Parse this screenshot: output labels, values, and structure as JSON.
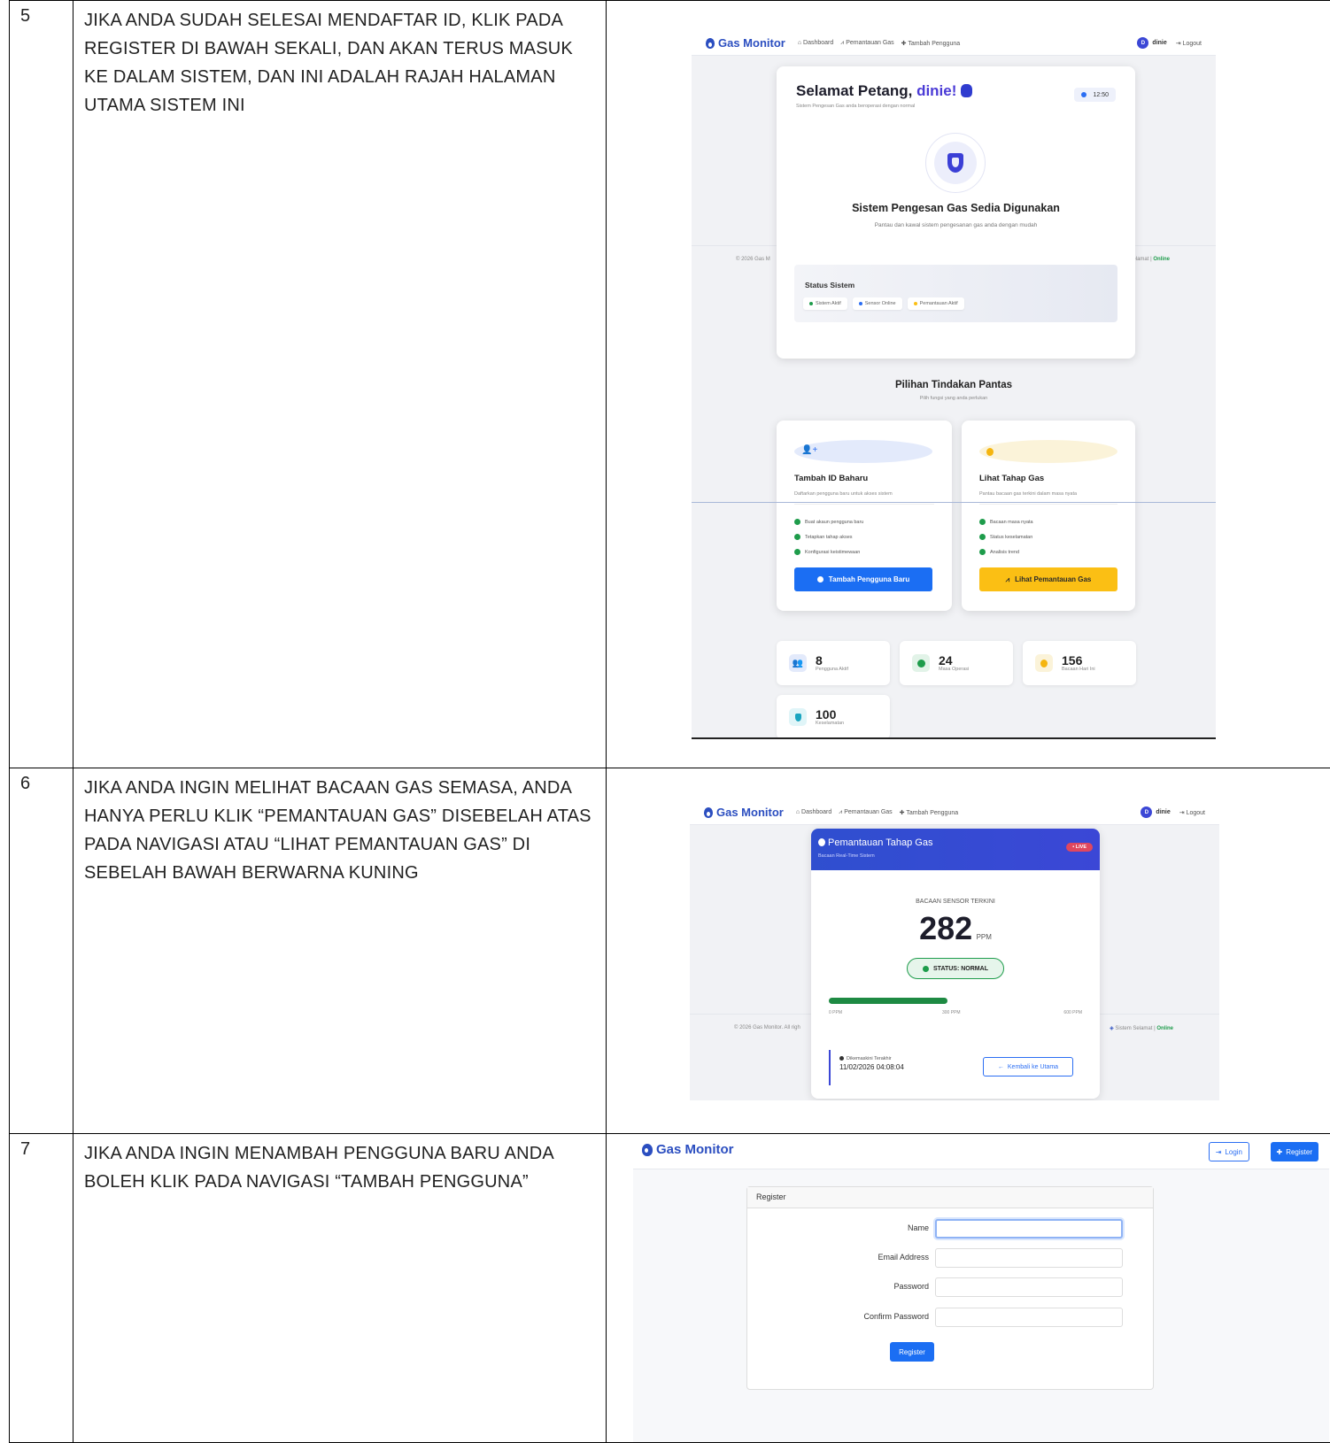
{
  "rows": [
    {
      "no": "5",
      "instruction": "JIKA ANDA SUDAH SELESAI MENDAFTAR ID, KLIK PADA REGISTER DI BAWAH SEKALI, DAN AKAN TERUS MASUK KE DALAM SISTEM, DAN INI ADALAH RAJAH HALAMAN UTAMA SISTEM INI"
    },
    {
      "no": "6",
      "instruction": "JIKA ANDA INGIN MELIHAT BACAAN GAS SEMASA, ANDA HANYA PERLU KLIK “PEMANTAUAN GAS” DISEBELAH ATAS PADA NAVIGASI ATAU “LIHAT PEMANTAUAN GAS” DI SEBELAH BAWAH BERWARNA KUNING"
    },
    {
      "no": "7",
      "instruction": "JIKA ANDA INGIN MENAMBAH PENGGUNA BARU ANDA BOLEH KLIK PADA NAVIGASI “TAMBAH PENGGUNA”"
    }
  ],
  "nav": {
    "brand": "Gas Monitor",
    "dashboard": "Dashboard",
    "monitoring": "Pemantauan Gas",
    "add_user": "Tambah Pengguna",
    "avatar_letter": "D",
    "user": "dinie",
    "logout": "Logout"
  },
  "dashboard": {
    "greeting": "Selamat Petang,",
    "username": "dinie!",
    "subtitle": "Sistem Pengesan Gas anda beroperasi dengan normal",
    "clock": "12:50",
    "hero_title": "Sistem Pengesan Gas Sedia Digunakan",
    "hero_sub": "Pantau dan kawal sistem pengesanan gas anda dengan mudah",
    "footer_left": "© 2026 Gas M",
    "footer_right_a": "elamat |",
    "footer_right_b": "Online",
    "status_title": "Status Sistem",
    "status_chips": [
      "Sistem Aktif",
      "Sensor Online",
      "Pemantauan Aktif"
    ],
    "quick_title": "Pilihan Tindakan Pantas",
    "quick_sub": "Pilih fungsi yang anda perlukan",
    "card_add": {
      "title": "Tambah ID Baharu",
      "sub": "Daftarkan pengguna baru untuk akses sistem",
      "items": [
        "Buat akaun pengguna baru",
        "Tetapkan tahap akses",
        "Konfigurasi keistimewaan"
      ],
      "button": "Tambah Pengguna Baru"
    },
    "card_gas": {
      "title": "Lihat Tahap Gas",
      "sub": "Pantau bacaan gas terkini dalam masa nyata",
      "items": [
        "Bacaan masa nyata",
        "Status keselamatan",
        "Analisis trend"
      ],
      "button": "Lihat Pemantauan Gas"
    },
    "stats": [
      {
        "value": "8",
        "label": "Pengguna Aktif",
        "icon": "users-icon"
      },
      {
        "value": "24",
        "label": "Masa Operasi",
        "icon": "check-icon"
      },
      {
        "value": "156",
        "label": "Bacaan Hari Ini",
        "icon": "flame-icon"
      },
      {
        "value": "100",
        "label": "Keselamatan",
        "icon": "shield-icon"
      }
    ]
  },
  "monitor": {
    "header_title": "Pemantauan Tahap Gas",
    "header_sub": "Bacaan Real-Time Sistem",
    "live": "LIVE",
    "reading_label": "BACAAN SENSOR TERKINI",
    "reading_value": "282",
    "unit": "PPM",
    "status": "STATUS: NORMAL",
    "gauge_level": 0.47,
    "scale": [
      "0 PPM",
      "300 PPM",
      "600 PPM"
    ],
    "footer_left": "© 2026 Gas Monitor. All righ",
    "footer_right_a": "Sistem Selamat |",
    "footer_right_b": "Online",
    "updated_label": "Dikemaskini Terakhir",
    "updated_value": "11/02/2026 04:08:04",
    "back_button": "Kembali ke Utama"
  },
  "register": {
    "brand": "Gas Monitor",
    "login": "Login",
    "register_btn": "Register",
    "panel_title": "Register",
    "fields": [
      "Name",
      "Email Address",
      "Password",
      "Confirm Password"
    ],
    "submit": "Register"
  },
  "colors": {
    "brand": "#2b4ec0",
    "blue_button": "#1b6ef3",
    "yellow_button": "#fbbf14",
    "green": "#1e9c4b",
    "violet": "#3b3fd6"
  }
}
